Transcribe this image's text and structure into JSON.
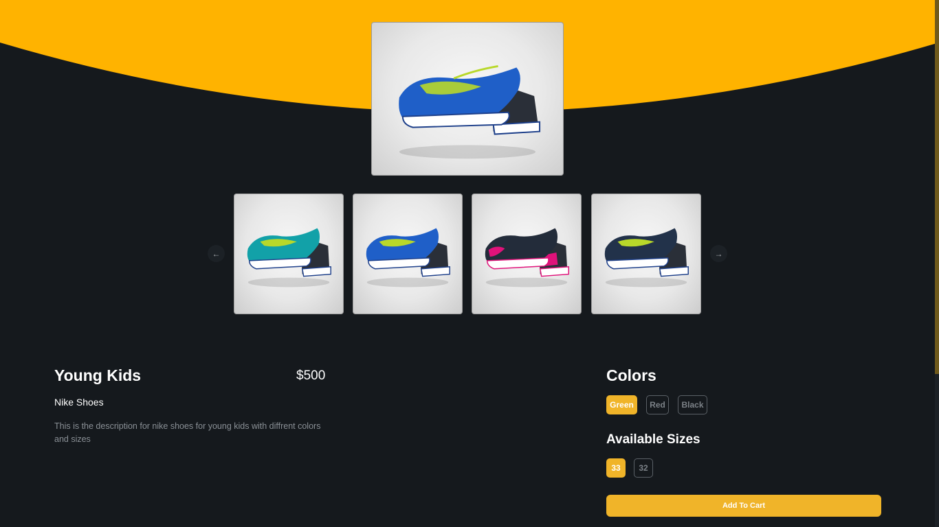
{
  "product": {
    "title": "Young Kids",
    "price": "$500",
    "brand": "Nike Shoes",
    "description": "This is the description for nike shoes for young kids with diffrent colors and sizes"
  },
  "gallery": {
    "prev_icon": "arrow-left-icon",
    "next_icon": "arrow-right-icon",
    "prev_glyph": "←",
    "next_glyph": "→",
    "thumbnails": [
      {
        "body": "#12a1a8",
        "accent": "#b8d82a",
        "heel": "#2a2f38"
      },
      {
        "body": "#1f5fc8",
        "accent": "#b8d82a",
        "heel": "#2a2f38"
      },
      {
        "body": "#232c3a",
        "accent": "#e0127a",
        "heel": "#2a2f38"
      },
      {
        "body": "#22324a",
        "accent": "#b8d82a",
        "heel": "#2a2f38"
      }
    ]
  },
  "colors": {
    "heading": "Colors",
    "options": [
      "Green",
      "Red",
      "Black"
    ],
    "selected": "Green"
  },
  "sizes": {
    "heading": "Available Sizes",
    "options": [
      "33",
      "32"
    ],
    "selected": "33"
  },
  "cart": {
    "label": "Add To Cart"
  },
  "theme": {
    "accent": "#f0b429",
    "banner": "#ffb300",
    "background": "#15191d"
  }
}
